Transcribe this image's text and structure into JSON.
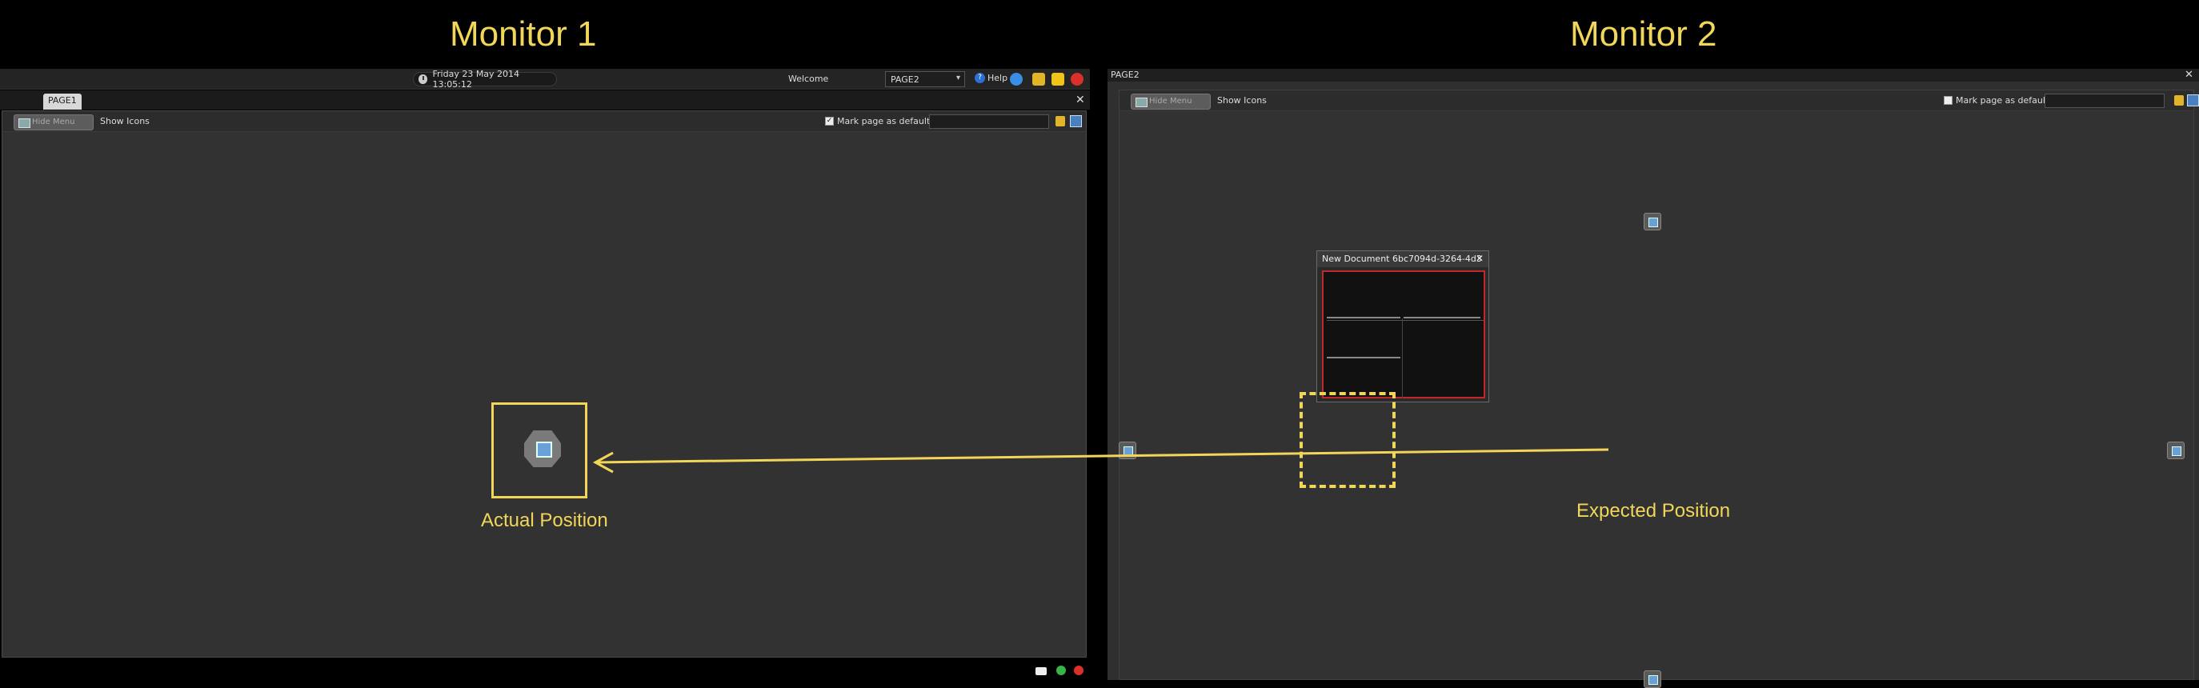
{
  "monitors": {
    "monitor1_title": "Monitor 1",
    "monitor2_title": "Monitor 2"
  },
  "monitor1": {
    "clock": "Friday  23 May 2014 13:05:12",
    "welcome": "Welcome",
    "page_select": "PAGE2",
    "help_label": "Help",
    "tab_label": "PAGE1",
    "toolbar": {
      "hide_menu": "Hide Menu",
      "show_icons": "Show Icons",
      "mark_default": "Mark page as default",
      "mark_checked": "✓"
    },
    "actual_label": "Actual Position"
  },
  "monitor2": {
    "window_title": "PAGE2",
    "toolbar": {
      "hide_menu": "Hide Menu",
      "show_icons": "Show Icons",
      "mark_default": "Mark page as default"
    },
    "doc_window_title": "New Document 6bc7094d-3264-4d3",
    "expected_label": "Expected Position"
  },
  "colors": {
    "accent_yellow": "#f2d65a",
    "doc_border_red": "#c0282a",
    "panel_bg": "#323232"
  }
}
